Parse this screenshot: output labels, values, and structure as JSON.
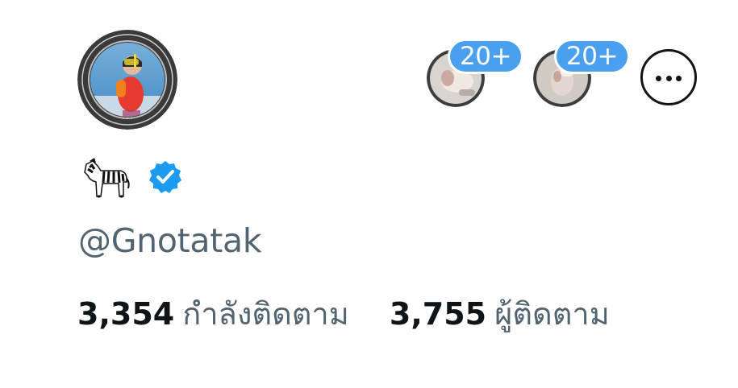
{
  "profile": {
    "avatar_icon": "profile-avatar-photo",
    "name_emoji": "🦓",
    "verified_icon": "verified-badge-icon",
    "handle": "@Gnotatak"
  },
  "highlights": [
    {
      "icon": "highlight-thumbnail",
      "badge": "20+"
    },
    {
      "icon": "highlight-thumbnail",
      "badge": "20+"
    }
  ],
  "more_button": {
    "icon": "more-horizontal-icon"
  },
  "stats": {
    "following_count": "3,354",
    "following_label": "กำลังติดตาม",
    "followers_count": "3,755",
    "followers_label": "ผู้ติดตาม"
  },
  "colors": {
    "accent": "#4aa0ef",
    "verified": "#1d9bf0",
    "text_primary": "#0f1419",
    "text_secondary": "#536471"
  }
}
